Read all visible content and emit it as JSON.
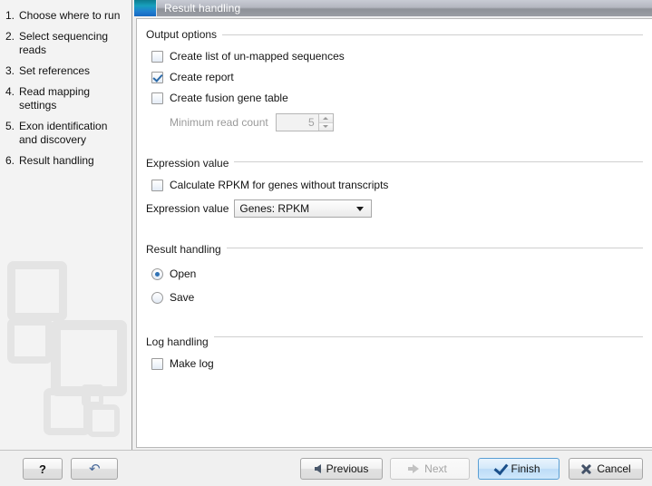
{
  "header": {
    "title": "Result handling",
    "accent_color": "#1f7fd0",
    "icon": "wizard-step-icon"
  },
  "sidebar": {
    "steps": [
      {
        "num": "1.",
        "label": "Choose where to run"
      },
      {
        "num": "2.",
        "label": "Select sequencing reads"
      },
      {
        "num": "3.",
        "label": "Set references"
      },
      {
        "num": "4.",
        "label": "Read mapping settings"
      },
      {
        "num": "5.",
        "label": "Exon identification and discovery"
      },
      {
        "num": "6.",
        "label": "Result handling"
      }
    ]
  },
  "groups": {
    "output_options": {
      "title": "Output options",
      "unmapped": {
        "label": "Create list of un-mapped sequences",
        "checked": false
      },
      "report": {
        "label": "Create report",
        "checked": true
      },
      "fusion": {
        "label": "Create fusion gene table",
        "checked": false
      },
      "min_read_count": {
        "label": "Minimum read count",
        "value": "5",
        "enabled": false
      }
    },
    "expression_value": {
      "title": "Expression value",
      "rpkm_no_transcripts": {
        "label": "Calculate RPKM for genes without transcripts",
        "checked": false
      },
      "combo": {
        "label": "Expression value",
        "value": "Genes: RPKM"
      }
    },
    "result_handling": {
      "title": "Result handling",
      "open": {
        "label": "Open",
        "selected": true
      },
      "save": {
        "label": "Save",
        "selected": false
      }
    },
    "log_handling": {
      "title": "Log handling",
      "make_log": {
        "label": "Make log",
        "checked": false
      }
    }
  },
  "footer": {
    "help_label": "?",
    "reset_label": "↷",
    "previous_label": "Previous",
    "next_label": "Next",
    "finish_label": "Finish",
    "cancel_label": "Cancel"
  }
}
